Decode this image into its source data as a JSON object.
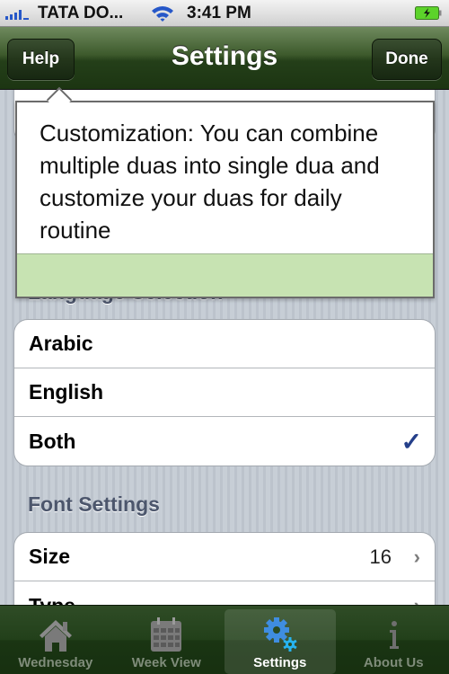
{
  "status_bar": {
    "carrier": "TATA DO...",
    "time": "3:41 PM",
    "icons": [
      "signal-icon",
      "wifi-icon",
      "battery-charging-icon"
    ]
  },
  "nav_bar": {
    "title": "Settings",
    "left_button": "Help",
    "right_button": "Done"
  },
  "popover": {
    "text": "Customization: You can combine multiple duas into single dua and customize your duas for daily routine",
    "footer_color": "#c7e3b2"
  },
  "sections": {
    "language": {
      "header": "Language Selection",
      "items": [
        {
          "label": "Arabic",
          "selected": false
        },
        {
          "label": "English",
          "selected": false
        },
        {
          "label": "Both",
          "selected": true
        }
      ],
      "check_icon": "checkmark-icon"
    },
    "font": {
      "header": "Font Settings",
      "items": [
        {
          "label": "Size",
          "value": "16",
          "icon": "chevron-right-icon"
        },
        {
          "label": "Type",
          "value": "",
          "icon": "chevron-right-icon"
        }
      ]
    }
  },
  "tab_bar": {
    "tabs": [
      {
        "label": "Wednesday",
        "icon": "home-icon",
        "active": false
      },
      {
        "label": "Week View",
        "icon": "calendar-icon",
        "active": false
      },
      {
        "label": "Settings",
        "icon": "gears-icon",
        "active": true
      },
      {
        "label": "About Us",
        "icon": "info-icon",
        "active": false
      }
    ]
  },
  "colors": {
    "nav_green": "#24401a",
    "checkmark": "#243f8a",
    "section_header": "#4c566c"
  }
}
